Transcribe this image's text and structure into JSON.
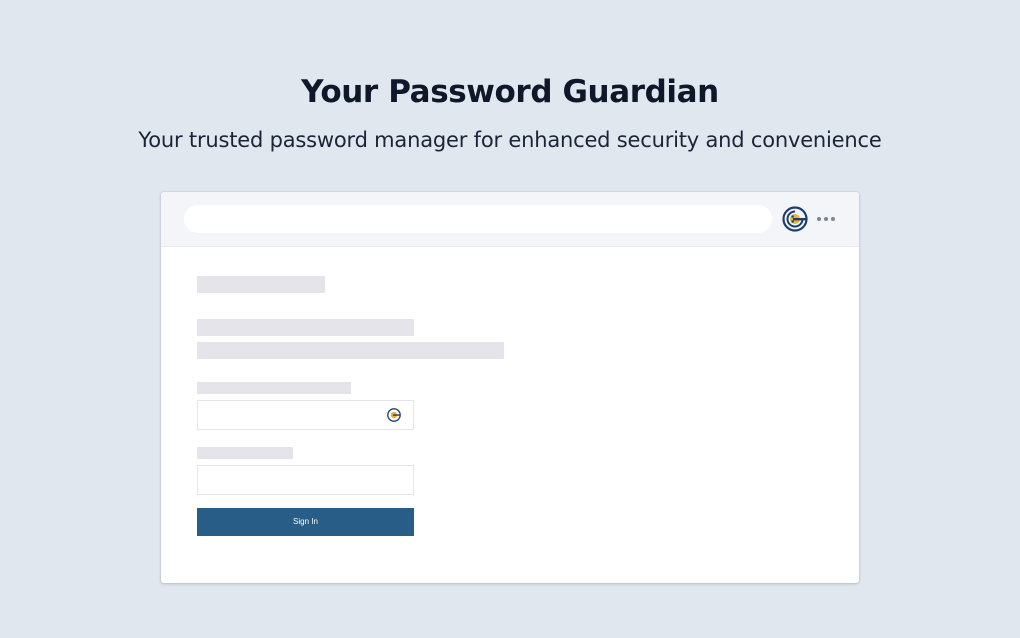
{
  "hero": {
    "title": "Your Password Guardian",
    "subtitle": "Your trusted password manager for enhanced security and convenience"
  },
  "browser": {
    "toolbar": {
      "extension_icon": "password-guardian-logo-icon",
      "menu_icon": "more-horizontal-icon"
    },
    "login_form": {
      "password_field_icon": "password-guardian-logo-icon",
      "sign_in_label": "Sign In"
    }
  },
  "colors": {
    "page_background": "#e1e7ef",
    "button": "#275d86",
    "logo_navy": "#1d3f6e",
    "logo_gold": "#e8b53c"
  }
}
